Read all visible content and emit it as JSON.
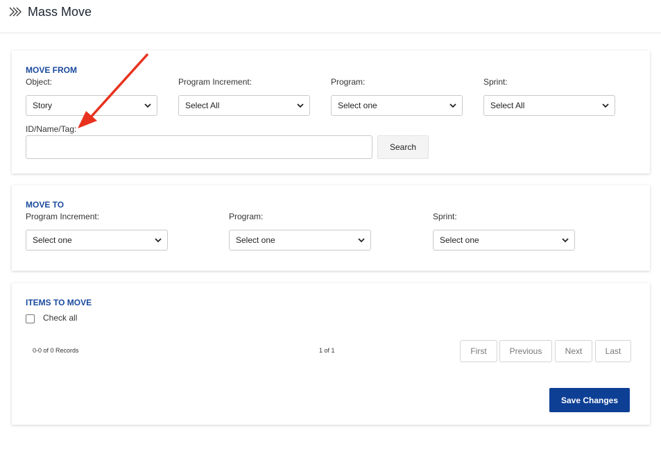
{
  "header": {
    "title": "Mass Move",
    "icon": "double-chevron-right-icon"
  },
  "move_from": {
    "title": "MOVE FROM",
    "object": {
      "label": "Object:",
      "value": "Story"
    },
    "program_increment": {
      "label": "Program Increment:",
      "value": "Select All"
    },
    "program": {
      "label": "Program:",
      "value": "Select one"
    },
    "sprint": {
      "label": "Sprint:",
      "value": "Select All"
    },
    "id_field": {
      "label": "ID/Name/Tag:",
      "value": "",
      "placeholder": ""
    },
    "search_label": "Search"
  },
  "move_to": {
    "title": "MOVE TO",
    "program_increment": {
      "label": "Program Increment:",
      "value": "Select one"
    },
    "program": {
      "label": "Program:",
      "value": "Select one"
    },
    "sprint": {
      "label": "Sprint:",
      "value": "Select one"
    }
  },
  "items_to_move": {
    "title": "ITEMS TO MOVE",
    "check_all_label": "Check all",
    "records_text": "0-0 of 0 Records",
    "page_text": "1 of 1",
    "pagination": {
      "first": "First",
      "previous": "Previous",
      "next": "Next",
      "last": "Last"
    },
    "save_label": "Save Changes"
  },
  "colors": {
    "accent": "#1a4a9e",
    "primary_button": "#0d3f95",
    "annotation_arrow": "#e8321e"
  }
}
